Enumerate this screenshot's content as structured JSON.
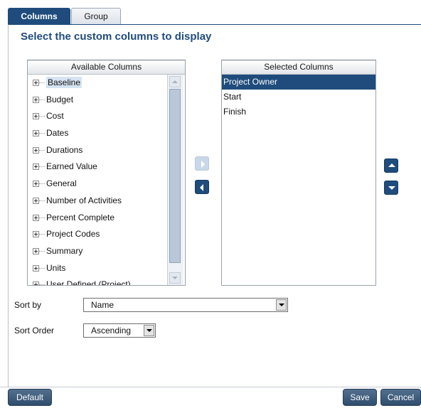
{
  "tabs": [
    {
      "label": "Columns",
      "active": true
    },
    {
      "label": "Group",
      "active": false
    }
  ],
  "heading": "Select the custom columns to display",
  "available": {
    "header": "Available Columns",
    "items": [
      "Baseline",
      "Budget",
      "Cost",
      "Dates",
      "Durations",
      "Earned Value",
      "General",
      "Number of Activities",
      "Percent Complete",
      "Project Codes",
      "Summary",
      "Units",
      "User Defined (Project)"
    ],
    "highlighted_index": 0
  },
  "selected": {
    "header": "Selected Columns",
    "items": [
      "Project Owner",
      "Start",
      "Finish"
    ],
    "selected_index": 0
  },
  "sort": {
    "sortby_label": "Sort by",
    "sortby_value": "Name",
    "sortorder_label": "Sort Order",
    "sortorder_value": "Ascending"
  },
  "footer": {
    "default_label": "Default",
    "save_label": "Save",
    "cancel_label": "Cancel"
  },
  "colors": {
    "accent": "#1f4c7c",
    "highlight": "#d6e3f2"
  },
  "icons": {
    "move_right": "arrow-right-icon",
    "move_left": "arrow-left-icon",
    "move_up": "arrow-up-icon",
    "move_down": "arrow-down-icon",
    "expand": "plus-box-icon"
  }
}
